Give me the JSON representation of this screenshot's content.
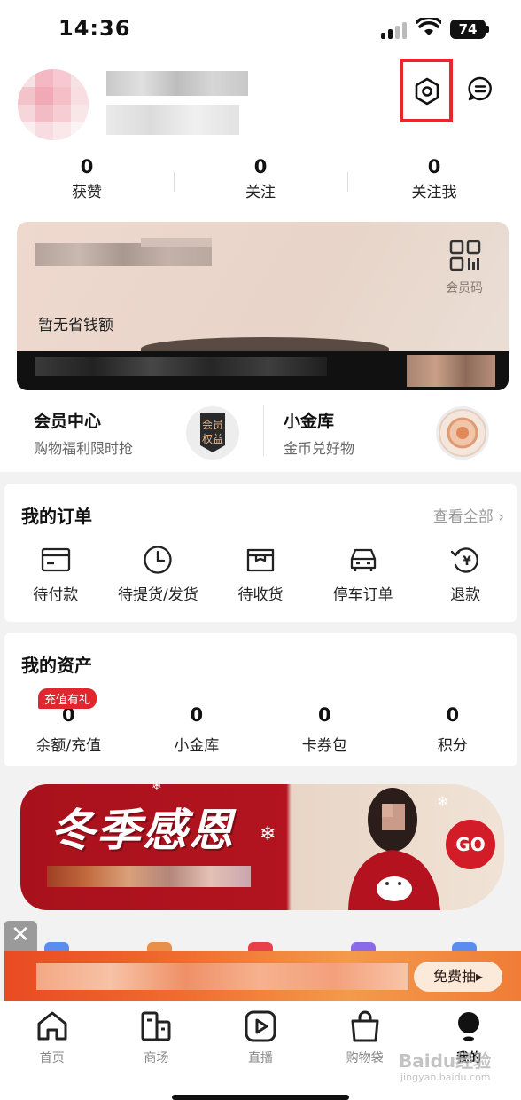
{
  "status_bar": {
    "time": "14:36",
    "battery": "74"
  },
  "profile": {
    "stats": [
      {
        "value": "0",
        "label": "获赞"
      },
      {
        "value": "0",
        "label": "关注"
      },
      {
        "value": "0",
        "label": "关注我"
      }
    ]
  },
  "member_card": {
    "qr_label": "会员码",
    "no_savings": "暂无省钱额"
  },
  "perks": [
    {
      "title": "会员中心",
      "subtitle": "购物福利限时抢",
      "badge": "会员\n权益"
    },
    {
      "title": "小金库",
      "subtitle": "金币兑好物"
    }
  ],
  "orders": {
    "title": "我的订单",
    "see_all": "查看全部",
    "items": [
      {
        "label": "待付款",
        "icon": "wallet-icon"
      },
      {
        "label": "待提货/发货",
        "icon": "clock-icon"
      },
      {
        "label": "待收货",
        "icon": "package-icon"
      },
      {
        "label": "停车订单",
        "icon": "car-icon"
      },
      {
        "label": "退款",
        "icon": "refund-icon"
      }
    ]
  },
  "assets": {
    "title": "我的资产",
    "topup_badge": "充值有礼",
    "items": [
      {
        "value": "0",
        "label": "余额/充值"
      },
      {
        "value": "0",
        "label": "小金库"
      },
      {
        "value": "0",
        "label": "卡券包"
      },
      {
        "value": "0",
        "label": "积分"
      }
    ]
  },
  "banner": {
    "title": "冬季感恩",
    "go": "GO"
  },
  "promo": {
    "button": "免费抽▸",
    "close": "✕"
  },
  "bottom_nav": [
    {
      "label": "首页",
      "icon": "home-icon"
    },
    {
      "label": "商场",
      "icon": "mall-icon"
    },
    {
      "label": "直播",
      "icon": "live-icon"
    },
    {
      "label": "购物袋",
      "icon": "bag-icon"
    },
    {
      "label": "我的",
      "icon": "profile-icon",
      "active": true
    }
  ],
  "watermark": {
    "text": "Baidu经验",
    "sub": "jingyan.baidu.com"
  }
}
